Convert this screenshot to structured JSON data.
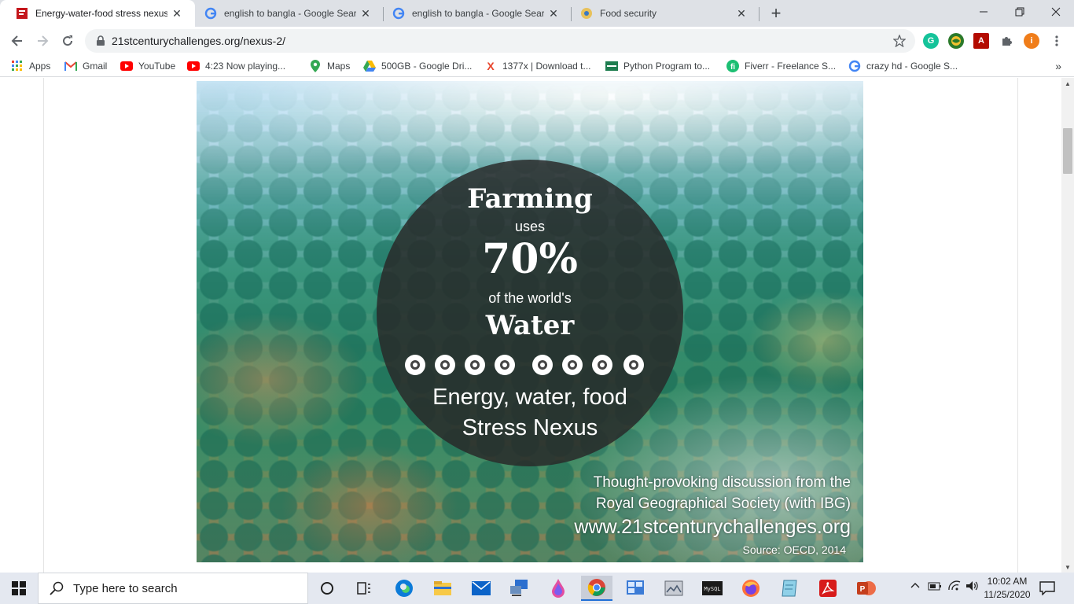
{
  "browser": {
    "tabs": [
      {
        "title": "Energy-water-food stress nexus |",
        "active": true,
        "icon": "red-doc-favicon"
      },
      {
        "title": "english to bangla - Google Searc",
        "active": false,
        "icon": "google-g-icon"
      },
      {
        "title": "english to bangla - Google Searc",
        "active": false,
        "icon": "google-g-icon"
      },
      {
        "title": "Food security",
        "active": false,
        "icon": "food-security-favicon"
      }
    ],
    "new_tab_symbol": "+",
    "address": "21stcenturychallenges.org/nexus-2/",
    "extensions": [
      {
        "name": "grammarly-icon",
        "color": "#15c39a",
        "glyph": "G"
      },
      {
        "name": "globe-extension-icon",
        "color": "#2b7a2b",
        "glyph": ""
      },
      {
        "name": "acrobat-extension-icon",
        "color": "#b30b00",
        "glyph": "A"
      },
      {
        "name": "puzzle-icon",
        "color": "#5f6368",
        "glyph": ""
      },
      {
        "name": "profile-avatar",
        "color": "#f07d1a",
        "glyph": "i"
      }
    ]
  },
  "bookmarks": [
    {
      "label": "Apps",
      "icon": "apps-grid-icon"
    },
    {
      "label": "Gmail",
      "icon": "gmail-icon"
    },
    {
      "label": "YouTube",
      "icon": "youtube-icon"
    },
    {
      "label": "4:23 Now playing...",
      "icon": "youtube-icon"
    },
    {
      "label": "Maps",
      "icon": "maps-icon"
    },
    {
      "label": "500GB - Google Dri...",
      "icon": "drive-icon"
    },
    {
      "label": "1377x | Download t...",
      "icon": "x-icon"
    },
    {
      "label": "Python Program to...",
      "icon": "site-icon"
    },
    {
      "label": "Fiverr - Freelance S...",
      "icon": "fiverr-icon"
    },
    {
      "label": "crazy hd - Google S...",
      "icon": "google-g-icon"
    }
  ],
  "bookmarks_more": "»",
  "hero": {
    "line1": "Farming",
    "line2": "uses",
    "line3": "70%",
    "line4": "of the world's",
    "line5": "Water",
    "line6": "Energy, water, food",
    "line7": "Stress Nexus",
    "credit1": "Thought-provoking discussion from the",
    "credit2": "Royal Geographical Society (with IBG)",
    "credit3": "www.21stcenturychallenges.org",
    "credit4": "Source: OECD, 2014"
  },
  "taskbar": {
    "search_placeholder": "Type here to search",
    "time": "10:02 AM",
    "date": "11/25/2020",
    "apps": [
      "cortana-icon",
      "task-view-icon",
      "edge-icon",
      "file-explorer-icon",
      "mail-icon",
      "network-app-icon",
      "paint-3d-icon",
      "chrome-icon",
      "control-panel-icon",
      "photos-app-icon",
      "matlab-icon",
      "firefox-icon",
      "notepad-app-icon",
      "acrobat-icon",
      "powerpoint-icon"
    ]
  }
}
